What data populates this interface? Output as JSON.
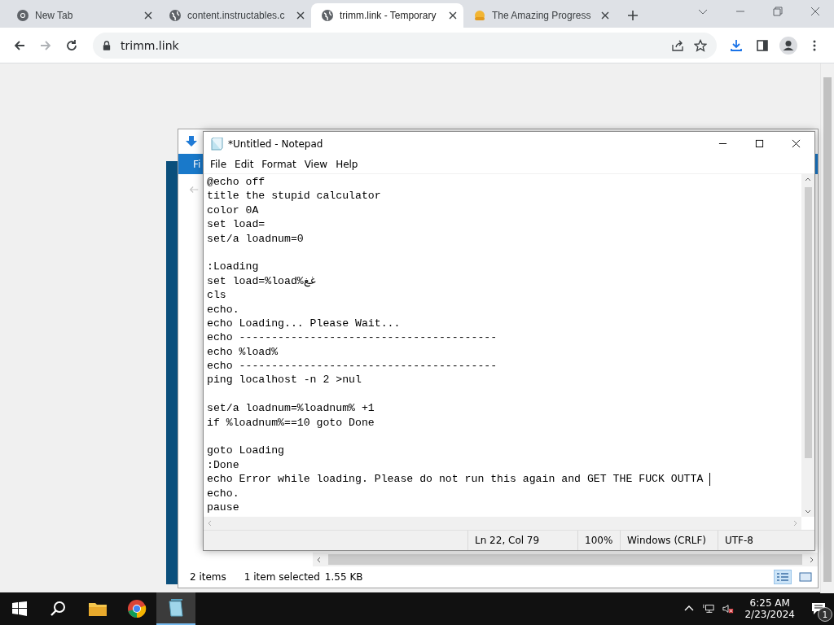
{
  "browser": {
    "tabs": [
      {
        "title": "New Tab",
        "kind": "chrome",
        "selected": false
      },
      {
        "title": "content.instructables.c",
        "kind": "globe",
        "selected": false
      },
      {
        "title": "trimm.link - Temporary",
        "kind": "globe",
        "selected": true
      },
      {
        "title": "The Amazing Progress",
        "kind": "emoji",
        "selected": false
      }
    ],
    "address": "trimm.link"
  },
  "explorer": {
    "ribbon_tab": "Fi",
    "status": {
      "items": "2 items",
      "selection": "1 item selected",
      "size": "1.55 KB"
    }
  },
  "notepad": {
    "title": "*Untitled - Notepad",
    "menu": [
      "File",
      "Edit",
      "Format",
      "View",
      "Help"
    ],
    "blocks": [
      {
        "lines": [
          {
            "text": "@echo off",
            "cursor": false
          },
          {
            "text": "title the stupid calculator",
            "cursor": false
          },
          {
            "text": "color 0A",
            "cursor": false
          },
          {
            "text": "set load=",
            "cursor": false
          },
          {
            "text": "set/a loadnum=0",
            "cursor": false
          }
        ]
      },
      {
        "lines": [
          {
            "text": ":Loading",
            "cursor": false
          },
          {
            "text": "set load=%load%غغ",
            "cursor": false
          },
          {
            "text": "cls",
            "cursor": false
          },
          {
            "text": "echo.",
            "cursor": false
          },
          {
            "text": "echo Loading... Please Wait...",
            "cursor": false
          },
          {
            "text": "echo ----------------------------------------",
            "cursor": false
          },
          {
            "text": "echo %load%",
            "cursor": false
          },
          {
            "text": "echo ----------------------------------------",
            "cursor": false
          },
          {
            "text": "ping localhost -n 2 >nul",
            "cursor": false
          }
        ]
      },
      {
        "lines": [
          {
            "text": "set/a loadnum=%loadnum% +1",
            "cursor": false
          },
          {
            "text": "if %loadnum%==10 goto Done",
            "cursor": false
          }
        ]
      },
      {
        "lines": [
          {
            "text": "goto Loading",
            "cursor": false
          },
          {
            "text": ":Done",
            "cursor": false
          },
          {
            "text": "echo Error while loading. Please do not run this again and GET THE FUCK OUTTA ",
            "cursor": true
          },
          {
            "text": "echo.",
            "cursor": false
          },
          {
            "text": "pause",
            "cursor": false
          }
        ]
      }
    ],
    "status": {
      "position": "Ln 22, Col 79",
      "zoom": "100%",
      "line_endings": "Windows (CRLF)",
      "encoding": "UTF-8"
    }
  },
  "taskbar": {
    "apps": [
      {
        "kind": "folder",
        "selected": false
      },
      {
        "kind": "chrome",
        "selected": false
      },
      {
        "kind": "notepad",
        "selected": true
      }
    ],
    "time": "6:25 AM",
    "date": "2/23/2024",
    "notifications": "1"
  }
}
